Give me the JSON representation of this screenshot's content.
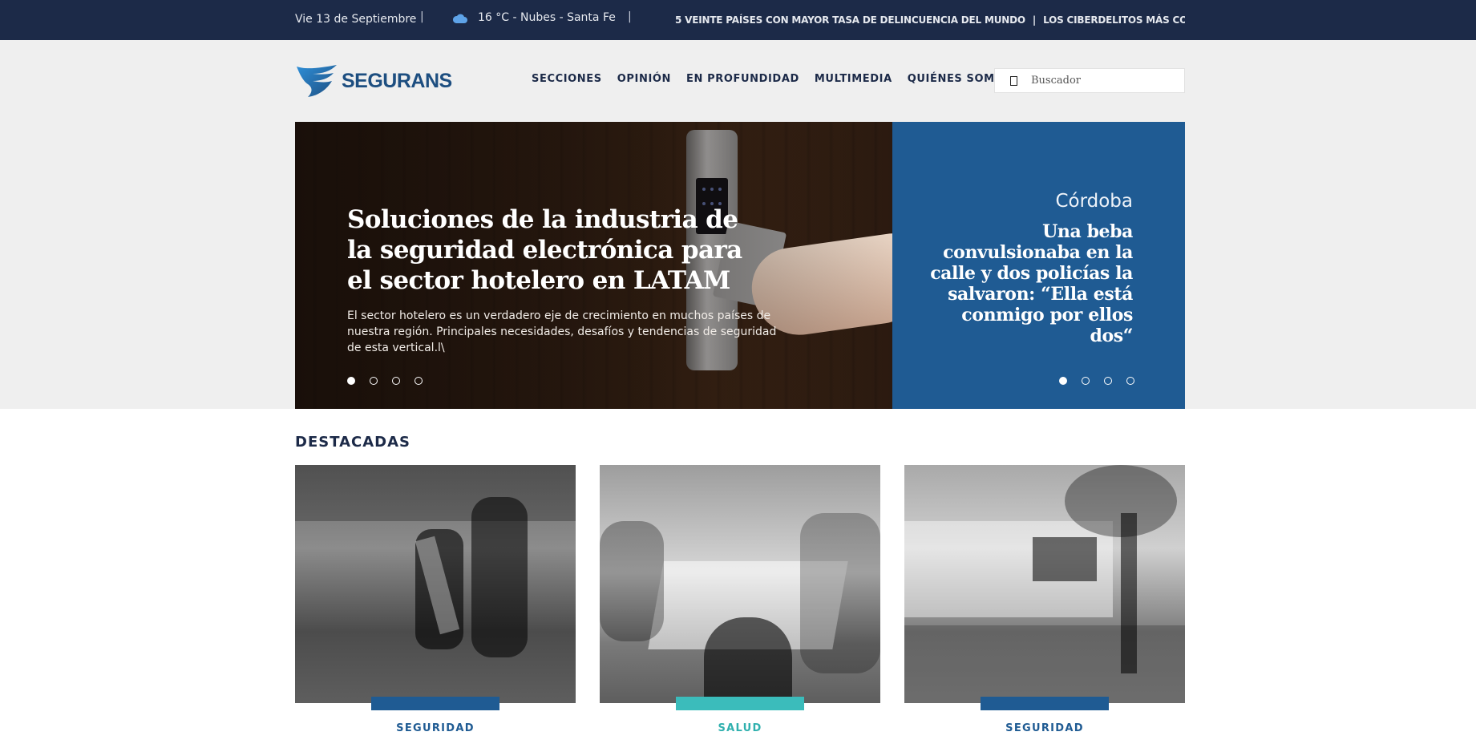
{
  "topbar": {
    "date": "Vie 13 de Septiembre",
    "separator": "|",
    "weather_icon": "cloud-icon",
    "weather": "16 °C - Nubes - Santa Fe",
    "ticker": [
      "5 VEINTE PAÍSES CON MAYOR TASA DE DELINCUENCIA DEL MUNDO",
      "LOS CIBERDELITOS MÁS COMUNES EN FAC"
    ]
  },
  "header": {
    "logo_text": "SEGURANS",
    "nav": [
      "SECCIONES",
      "OPINIÓN",
      "EN PROFUNDIDAD",
      "MULTIMEDIA",
      "QUIÉNES SOMOS"
    ],
    "search_placeholder": "Buscador"
  },
  "hero": {
    "title": "Soluciones de la industria de la seguridad electrónica para el sector hotelero en LATAM",
    "summary": "El sector hotelero es un verdadero eje de crecimiento en muchos países de nuestra región. Principales necesidades, desafíos y tendencias de seguridad de esta vertical.l\\",
    "dots": 4,
    "active_dot": 1
  },
  "side": {
    "place": "Córdoba",
    "title": "Una beba convulsionaba en la calle y dos policías la salvaron: “Ella está conmigo por ellos dos“",
    "dots": 4,
    "active_dot": 1
  },
  "featured": {
    "title": "DESTACADAS",
    "items": [
      {
        "category": "SEGURIDAD",
        "color": "#1f5b93"
      },
      {
        "category": "SALUD",
        "color": "#3bbcbb"
      },
      {
        "category": "SEGURIDAD",
        "color": "#1f5b93"
      }
    ]
  },
  "colors": {
    "topbar": "#1c2a48",
    "header_bg": "#efefef",
    "accent_blue": "#1f5b93",
    "accent_teal": "#3bbcbb"
  }
}
